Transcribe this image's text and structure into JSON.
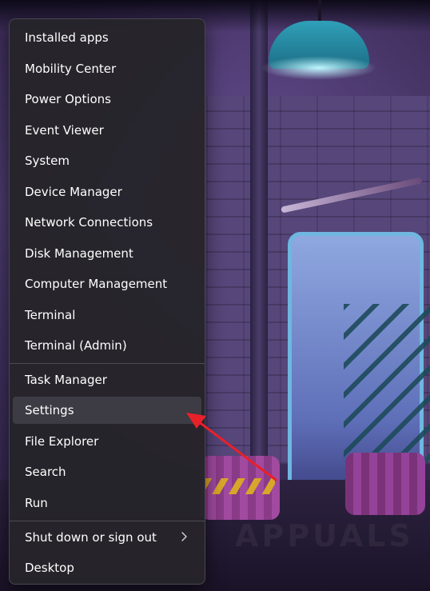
{
  "menu": {
    "group1": [
      {
        "label": "Installed apps"
      },
      {
        "label": "Mobility Center"
      },
      {
        "label": "Power Options"
      },
      {
        "label": "Event Viewer"
      },
      {
        "label": "System"
      },
      {
        "label": "Device Manager"
      },
      {
        "label": "Network Connections"
      },
      {
        "label": "Disk Management"
      },
      {
        "label": "Computer Management"
      },
      {
        "label": "Terminal"
      },
      {
        "label": "Terminal (Admin)"
      }
    ],
    "group2": [
      {
        "label": "Task Manager"
      },
      {
        "label": "Settings",
        "highlighted": true
      },
      {
        "label": "File Explorer"
      },
      {
        "label": "Search"
      },
      {
        "label": "Run"
      }
    ],
    "group3": [
      {
        "label": "Shut down or sign out",
        "submenu_icon": "chevron-right-icon"
      },
      {
        "label": "Desktop"
      }
    ]
  },
  "annotation": {
    "type": "arrow",
    "color": "#e8202a",
    "points_to": "Settings"
  },
  "watermark": {
    "text": "APPUALS"
  },
  "colors": {
    "menu_bg": "#26242a",
    "highlight": "#3d3b43",
    "text": "#ffffff"
  }
}
